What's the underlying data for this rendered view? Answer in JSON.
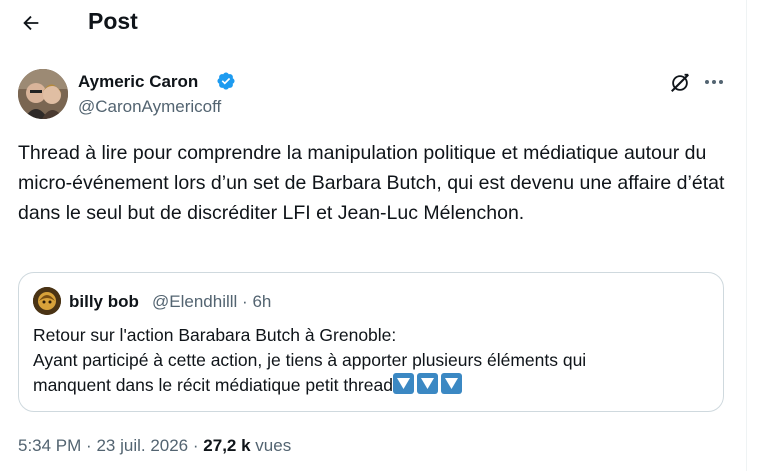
{
  "header": {
    "title": "Post",
    "back_icon": "arrow-left-icon"
  },
  "post": {
    "author_name": "Aymeric Caron",
    "author_handle": "@CaronAymericoff",
    "verified": true,
    "text": "Thread à lire pour comprendre la manipulation politique et médiatique autour du micro-événement lors d’un set de Barbara Butch, qui est devenu une affaire d’état dans le seul but de discréditer LFI et Jean-Luc Mélenchon."
  },
  "quote": {
    "author_name": "billy bob",
    "author_handle": "@Elendhilll",
    "separator": "·",
    "age": "6h",
    "lines": [
      "Retour sur l'action Barabara Butch à Grenoble:",
      "Ayant participé à cette action, je tiens à apporter plusieurs éléments qui",
      "manquent dans le récit médiatique petit thread"
    ],
    "emoji_count": 3
  },
  "meta": {
    "time": "5:34 PM",
    "sep1": "·",
    "date": "23 juil. 2026",
    "sep2": "·",
    "views_count": "27,2 k",
    "views_label": "vues"
  },
  "colors": {
    "text": "#0f1419",
    "secondary": "#536471",
    "verified": "#1d9bf0",
    "border": "#cfd9de",
    "emoji": "#3b88c3"
  }
}
